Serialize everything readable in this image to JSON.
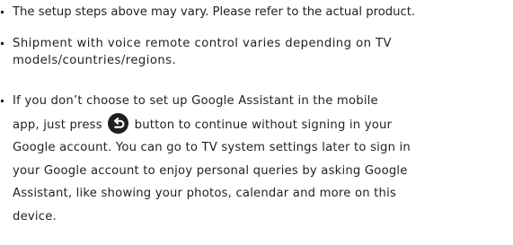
{
  "notes": [
    {
      "lines": [
        "The setup steps above may vary. Please refer to the actual product."
      ]
    },
    {
      "lines": [
        "Shipment with voice remote control varies depending on TV",
        "models/countries/regions."
      ]
    },
    {
      "line1": "If you don’t choose to set up Google Assistant in the mobile",
      "line2_before_icon": "app, just press",
      "icon": "back-button-icon",
      "line2_after_icon": "button to continue without signing in your",
      "lines_rest": [
        "Google account. You can go to TV system settings later to sign in",
        "your Google account to enjoy personal queries by asking Google",
        "Assistant, like showing your photos, calendar and more on this",
        "device."
      ]
    }
  ],
  "colors": {
    "text": "#231f20",
    "icon_fill": "#231f20",
    "icon_arrow": "#ffffff"
  }
}
